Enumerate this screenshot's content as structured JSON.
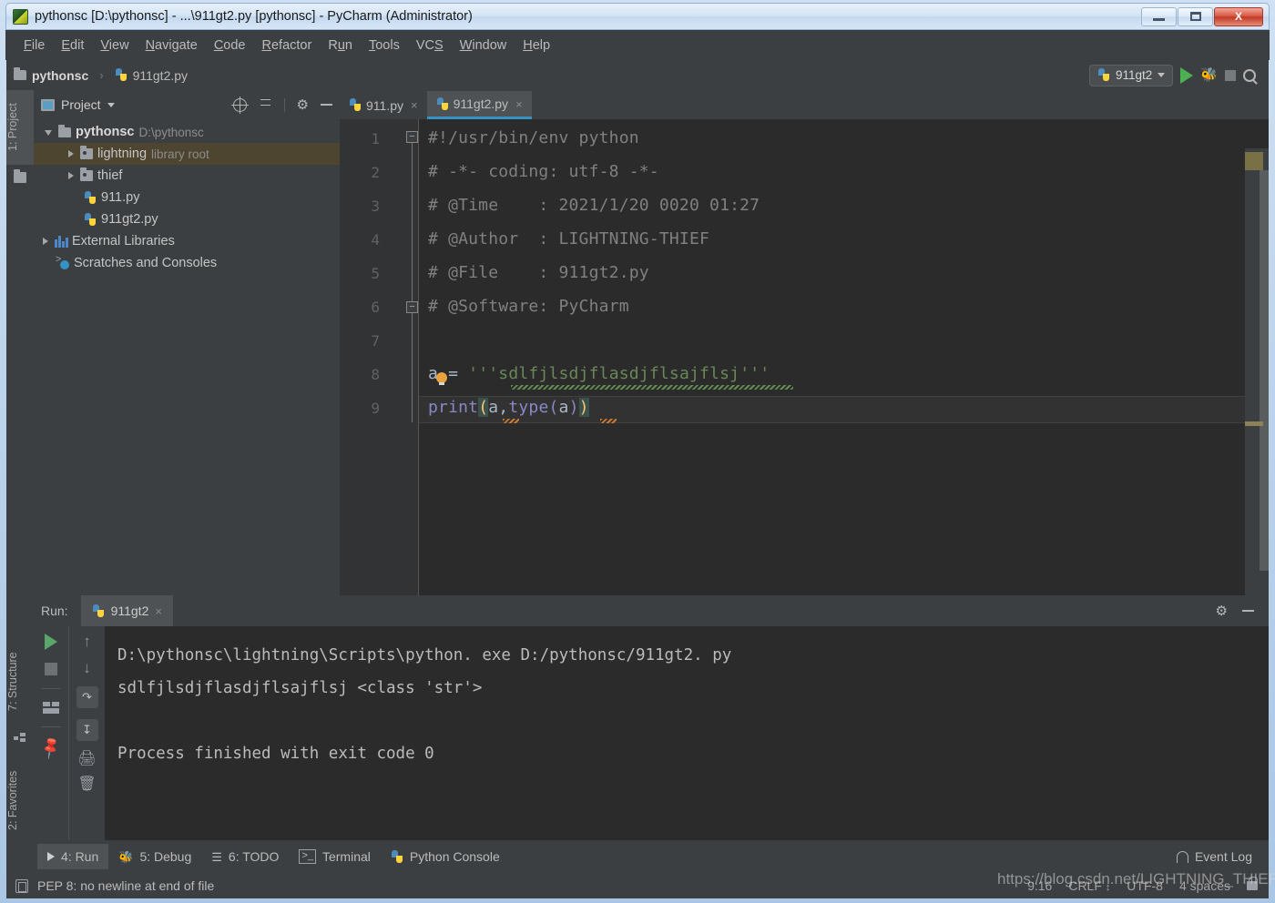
{
  "window": {
    "title": "pythonsc [D:\\pythonsc] - ...\\911gt2.py [pythonsc] - PyCharm (Administrator)",
    "app_icon": "pycharm-icon",
    "minimize_label": "",
    "maximize_label": "",
    "close_label": "X"
  },
  "menubar": {
    "items": [
      {
        "label": "File",
        "mnemonic": "F"
      },
      {
        "label": "Edit",
        "mnemonic": "E"
      },
      {
        "label": "View",
        "mnemonic": "V"
      },
      {
        "label": "Navigate",
        "mnemonic": "N"
      },
      {
        "label": "Code",
        "mnemonic": "C"
      },
      {
        "label": "Refactor",
        "mnemonic": "R"
      },
      {
        "label": "Run",
        "mnemonic": "u"
      },
      {
        "label": "Tools",
        "mnemonic": "T"
      },
      {
        "label": "VCS",
        "mnemonic": "S"
      },
      {
        "label": "Window",
        "mnemonic": "W"
      },
      {
        "label": "Help",
        "mnemonic": "H"
      }
    ]
  },
  "navbar": {
    "breadcrumbs": [
      {
        "label": "pythonsc",
        "icon": "folder-icon"
      },
      {
        "label": "911gt2.py",
        "icon": "python-file-icon"
      }
    ],
    "separator": "›",
    "run_config": {
      "label": "911gt2",
      "icon": "python-icon"
    },
    "buttons": [
      {
        "name": "run-button",
        "icon": "play-icon"
      },
      {
        "name": "debug-button",
        "icon": "bug-icon"
      },
      {
        "name": "stop-button",
        "icon": "stop-icon"
      },
      {
        "name": "search-everywhere-button",
        "icon": "search-icon"
      }
    ]
  },
  "left_tool_strips": {
    "top": [
      {
        "label": "1: Project",
        "active": true,
        "icon": "folder-icon"
      }
    ],
    "bottom": [
      {
        "label": "7: Structure",
        "active": false,
        "icon": "structure-icon"
      },
      {
        "label": "2: Favorites",
        "active": false,
        "icon": "star-icon"
      }
    ]
  },
  "project_panel": {
    "title": "Project",
    "header_icons": [
      "locate-icon",
      "collapse-all-icon",
      "gear-icon",
      "hide-icon"
    ],
    "tree": [
      {
        "indent": 0,
        "arrow": "down",
        "icon": "folder-icon",
        "label": "pythonsc",
        "sub": "D:\\pythonsc",
        "bold": true,
        "selected": false
      },
      {
        "indent": 1,
        "arrow": "right",
        "icon": "library-icon",
        "label": "lightning",
        "sub": "library root",
        "bold": false,
        "selected": true
      },
      {
        "indent": 1,
        "arrow": "right",
        "icon": "library-icon",
        "label": "thief",
        "sub": "",
        "bold": false,
        "selected": false
      },
      {
        "indent": 2,
        "arrow": "none",
        "icon": "python-file-icon",
        "label": "911.py",
        "sub": "",
        "bold": false,
        "selected": false
      },
      {
        "indent": 2,
        "arrow": "none",
        "icon": "python-file-icon",
        "label": "911gt2.py",
        "sub": "",
        "bold": false,
        "selected": false
      },
      {
        "indent": 0,
        "arrow": "right",
        "icon": "external-libraries-icon",
        "label": "External Libraries",
        "sub": "",
        "bold": false,
        "selected": false
      },
      {
        "indent": 0,
        "arrow": "none",
        "icon": "scratches-icon",
        "label": "Scratches and Consoles",
        "sub": "",
        "bold": false,
        "selected": false
      }
    ]
  },
  "editor": {
    "tabs": [
      {
        "label": "911.py",
        "active": false,
        "icon": "python-file-icon",
        "close": "×"
      },
      {
        "label": "911gt2.py",
        "active": true,
        "icon": "python-file-icon",
        "close": "×"
      }
    ],
    "line_numbers": [
      "1",
      "2",
      "3",
      "4",
      "5",
      "6",
      "7",
      "8",
      "9"
    ],
    "code_lines": [
      {
        "n": 1,
        "text": "#!/usr/bin/env python"
      },
      {
        "n": 2,
        "text": "# -*- coding: utf-8 -*-"
      },
      {
        "n": 3,
        "text": "# @Time    : 2021/1/20 0020 01:27"
      },
      {
        "n": 4,
        "text": "# @Author  : LIGHTNING-THIEF"
      },
      {
        "n": 5,
        "text": "# @File    : 911gt2.py"
      },
      {
        "n": 6,
        "text": "# @Software: PyCharm"
      },
      {
        "n": 7,
        "text": ""
      },
      {
        "n": 8,
        "text": "a = '''sdlfjlsdjflasdjflsajflsj'''"
      },
      {
        "n": 9,
        "text": "print(a,type(a))"
      }
    ],
    "line8_parts": {
      "var": "a",
      "eq": " = ",
      "quote_open": "'''",
      "string": "sdlfjlsdjflasdjflsajflsj",
      "quote_close": "'''"
    },
    "line9_parts": {
      "func": "print",
      "open": "(",
      "arg1": "a",
      "comma": ",",
      "func2": "type",
      "open2": "(",
      "arg2": "a",
      "close2": ")",
      "close": ")"
    }
  },
  "run_panel": {
    "label": "Run:",
    "tab": {
      "label": "911gt2",
      "icon": "python-icon",
      "close": "×"
    },
    "header_icons": [
      "gear-icon",
      "hide-icon"
    ],
    "tool_icons": [
      "rerun-icon",
      "stop-icon",
      "layout-icon",
      "pin-icon",
      "up-arrow-icon",
      "down-arrow-icon",
      "soft-wrap-icon",
      "scroll-to-end-icon",
      "print-icon",
      "trash-icon"
    ],
    "console_lines": [
      "D:\\pythonsc\\lightning\\Scripts\\python. exe D:/pythonsc/911gt2. py",
      "sdlfjlsdjflasdjflsajflsj <class 'str'>",
      "",
      "Process finished with exit code 0"
    ]
  },
  "bottom_bar": {
    "items": [
      {
        "label": "4: Run",
        "mnemonic": "4",
        "icon": "play-icon",
        "active": true
      },
      {
        "label": "5: Debug",
        "mnemonic": "5",
        "icon": "bug-icon",
        "active": false
      },
      {
        "label": "6: TODO",
        "mnemonic": "6",
        "icon": "todo-icon",
        "active": false
      },
      {
        "label": "Terminal",
        "mnemonic": "",
        "icon": "terminal-icon",
        "active": false
      },
      {
        "label": "Python Console",
        "mnemonic": "",
        "icon": "python-icon",
        "active": false
      }
    ],
    "event_log": {
      "label": "Event Log",
      "icon": "event-log-icon"
    }
  },
  "status_bar": {
    "message": "PEP 8: no newline at end of file",
    "message_icon": "inspection-icon",
    "caret_position": "9:16",
    "line_separator": "CRLF",
    "encoding": "UTF-8",
    "indent": "4 spaces",
    "lock_icon": "lock-icon"
  },
  "watermark": {
    "text": "https://blog.csdn.net/LIGHTNING_THIEF"
  },
  "colors": {
    "accent": "#3592c4",
    "panel_bg": "#3c3f41",
    "editor_bg": "#2b2b2b",
    "gutter_bg": "#313335",
    "selection": "#4e4530",
    "string": "#6a8759",
    "keyword": "#8888c6",
    "comment": "#808080",
    "bracket": "#ffc66d",
    "green_run": "#59a869"
  }
}
